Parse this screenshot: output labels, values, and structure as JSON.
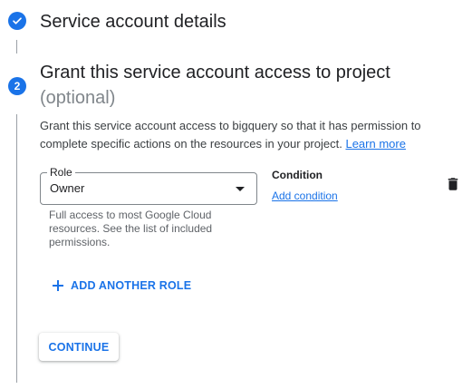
{
  "steps": {
    "completed": {
      "title": "Service account details",
      "icon": "check-icon"
    },
    "current": {
      "number": "2",
      "title": "Grant this service account access to project",
      "optional": "(optional)",
      "description": "Grant this service account access to bigquery so that it has permission to complete specific actions on the resources in your project.",
      "learn_more": "Learn more"
    }
  },
  "role": {
    "label": "Role",
    "value": "Owner",
    "help": "Full access to most Google Cloud resources. See the list of included permissions."
  },
  "condition": {
    "label": "Condition",
    "add_link": "Add condition"
  },
  "actions": {
    "add_role": "ADD ANOTHER ROLE",
    "continue": "CONTINUE",
    "delete_icon": "trash-icon",
    "add_icon": "plus-icon"
  },
  "colors": {
    "accent": "#1a73e8",
    "text_primary": "#202124",
    "text_secondary": "#5f6368",
    "optional_gray": "#80868b"
  }
}
